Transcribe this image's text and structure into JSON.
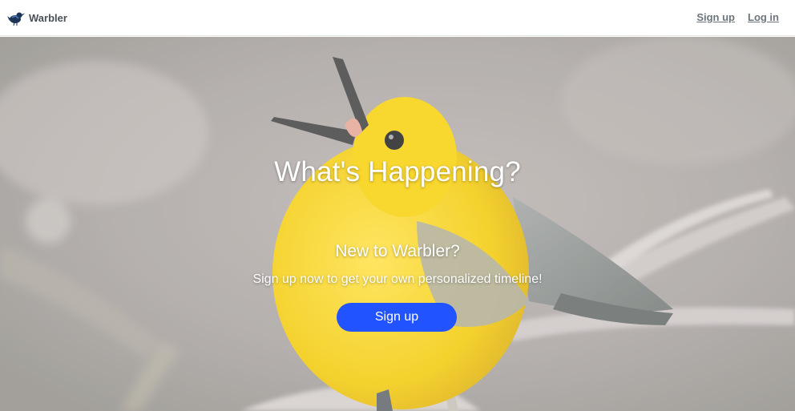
{
  "navbar": {
    "brand_name": "Warbler",
    "brand_icon": "warbler-bird-logo",
    "links": [
      {
        "label": "Sign up"
      },
      {
        "label": "Log in"
      }
    ]
  },
  "hero": {
    "title": "What's Happening?",
    "subtitle": "New to Warbler?",
    "lead": "Sign up now to get your own personalized timeline!",
    "button_label": "Sign up",
    "button_color": "#2153ff",
    "background": "photo of a yellow warbler singing on a branch"
  }
}
